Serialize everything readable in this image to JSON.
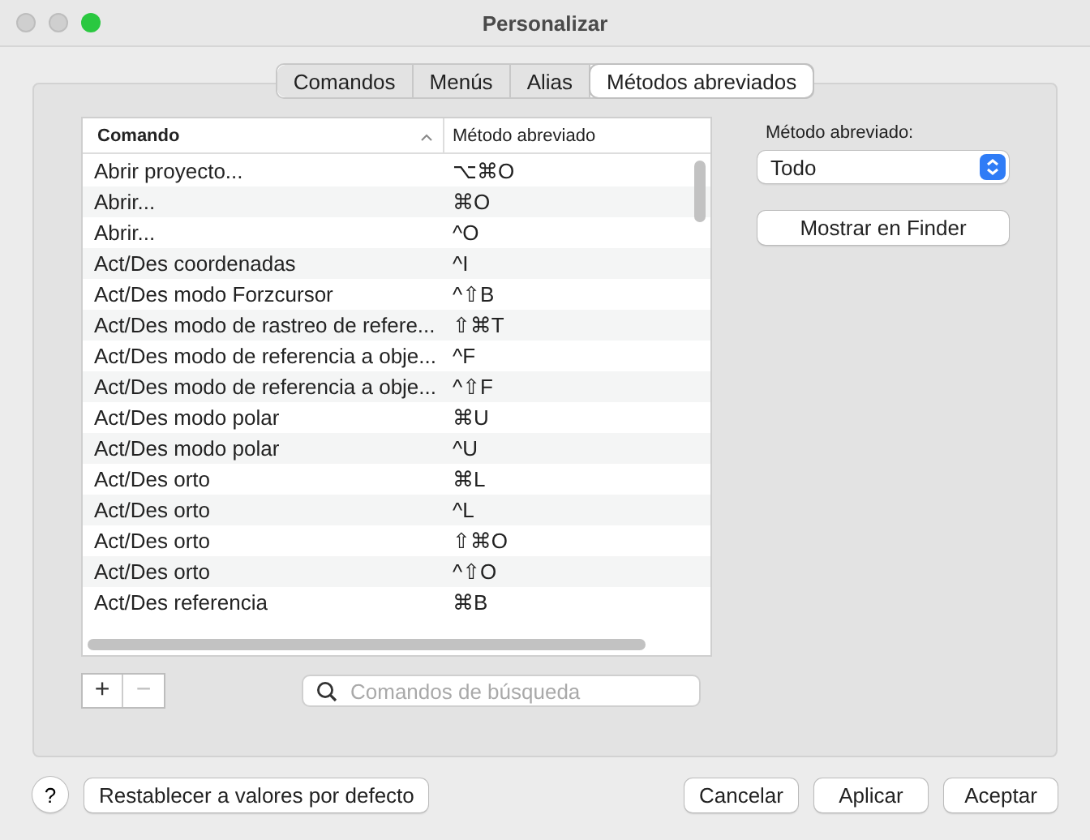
{
  "window": {
    "title": "Personalizar"
  },
  "tabs": [
    {
      "label": "Comandos",
      "selected": false
    },
    {
      "label": "Menús",
      "selected": false
    },
    {
      "label": "Alias",
      "selected": false
    },
    {
      "label": "Métodos abreviados",
      "selected": true
    }
  ],
  "table": {
    "columns": [
      "Comando",
      "Método abreviado"
    ],
    "rows": [
      {
        "command": "Abrir proyecto...",
        "shortcut": "⌥⌘O"
      },
      {
        "command": "Abrir...",
        "shortcut": "⌘O"
      },
      {
        "command": "Abrir...",
        "shortcut": "^O"
      },
      {
        "command": "Act/Des coordenadas",
        "shortcut": "^I"
      },
      {
        "command": "Act/Des modo Forzcursor",
        "shortcut": "^⇧B"
      },
      {
        "command": "Act/Des modo de rastreo de refere...",
        "shortcut": "⇧⌘T"
      },
      {
        "command": "Act/Des modo de referencia a obje...",
        "shortcut": "^F"
      },
      {
        "command": "Act/Des modo de referencia a obje...",
        "shortcut": "^⇧F"
      },
      {
        "command": "Act/Des modo polar",
        "shortcut": "⌘U"
      },
      {
        "command": "Act/Des modo polar",
        "shortcut": "^U"
      },
      {
        "command": "Act/Des orto",
        "shortcut": "⌘L"
      },
      {
        "command": "Act/Des orto",
        "shortcut": "^L"
      },
      {
        "command": "Act/Des orto",
        "shortcut": "⇧⌘O"
      },
      {
        "command": "Act/Des orto",
        "shortcut": "^⇧O"
      },
      {
        "command": "Act/Des referencia",
        "shortcut": "⌘B"
      }
    ]
  },
  "add_button": "+",
  "remove_button": {
    "label": "−",
    "disabled": true
  },
  "search": {
    "placeholder": "Comandos de búsqueda"
  },
  "filter": {
    "label": "Método abreviado:",
    "value": "Todo"
  },
  "show_button": "Mostrar en Finder",
  "help_button": "?",
  "reset_button": "Restablecer a valores por defecto",
  "buttons": [
    "Cancelar",
    "Aplicar",
    "Aceptar"
  ]
}
